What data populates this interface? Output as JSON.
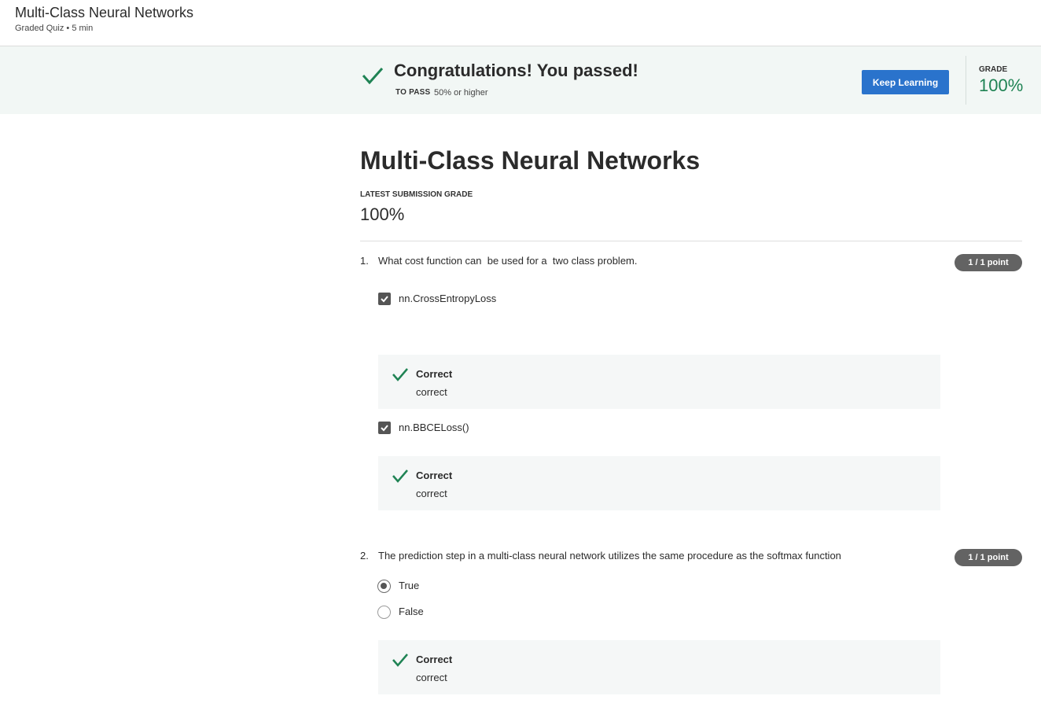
{
  "header": {
    "title": "Multi-Class Neural Networks",
    "subtitle": "Graded Quiz • 5 min"
  },
  "banner": {
    "message": "Congratulations! You passed!",
    "to_pass_label": "TO PASS",
    "to_pass_value": "50% or higher",
    "keep_learning_label": "Keep Learning",
    "grade_label": "GRADE",
    "grade_value": "100%",
    "accent_color": "#1f8354",
    "button_color": "#2a73cc"
  },
  "quiz": {
    "title": "Multi-Class Neural Networks",
    "latest_label": "LATEST SUBMISSION GRADE",
    "latest_value": "100%",
    "questions": [
      {
        "number": "1.",
        "text": "What cost function can  be used for a  two class problem.",
        "points": "1 / 1 point",
        "type": "checkbox",
        "options": [
          {
            "label": "nn.CrossEntropyLoss",
            "selected": true,
            "feedback": {
              "title": "Correct",
              "text": "correct"
            }
          },
          {
            "label": "nn.BBCELoss()",
            "selected": true,
            "feedback": {
              "title": "Correct",
              "text": "correct"
            }
          }
        ]
      },
      {
        "number": "2.",
        "text": "The prediction step in a multi-class neural network utilizes the same procedure as the softmax function",
        "points": "1 / 1 point",
        "type": "radio",
        "options": [
          {
            "label": "True",
            "selected": true
          },
          {
            "label": "False",
            "selected": false
          }
        ],
        "feedback": {
          "title": "Correct",
          "text": "correct"
        }
      }
    ]
  },
  "icons": {
    "pass": "check-icon",
    "feedback": "check-icon"
  }
}
